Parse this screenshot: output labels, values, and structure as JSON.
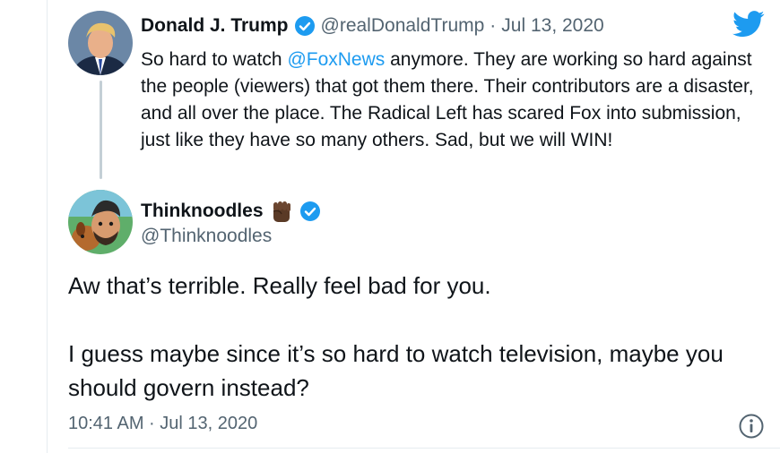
{
  "tweet": {
    "author_name": "Donald J. Trump",
    "author_handle": "@realDonaldTrump",
    "separator": "·",
    "date": "Jul 13, 2020",
    "text_before": "So hard to watch ",
    "mention": "@FoxNews",
    "text_after": " anymore. They are working so hard against the people (viewers) that got them there. Their contributors are a disaster, and all over the place. The Radical Left has scared Fox into submission, just like they have so many others. Sad, but we will WIN!"
  },
  "reply": {
    "author_name": "Thinknoodles",
    "author_handle": "@Thinknoodles",
    "paragraph1": "Aw that’s terrible. Really feel bad for you.",
    "paragraph2": "I guess maybe since it’s so hard to watch television, maybe you should govern instead?",
    "timestamp": "10:41 AM · Jul 13, 2020"
  },
  "colors": {
    "accent": "#1d9bf0",
    "text": "#0f1419",
    "secondary_text": "#536471",
    "thread_line": "#c4cfd6"
  },
  "icons": {
    "brand": "twitter-bird-icon",
    "verified": "verified-badge-icon",
    "fist": "raised-fist-emoji",
    "info": "info-icon"
  }
}
